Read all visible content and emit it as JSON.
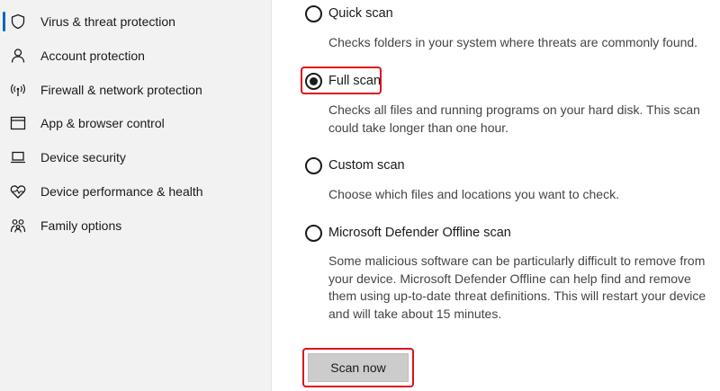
{
  "sidebar": {
    "items": [
      {
        "label": "Virus & threat protection",
        "icon": "shield-icon",
        "active": true
      },
      {
        "label": "Account protection",
        "icon": "person-icon"
      },
      {
        "label": "Firewall & network protection",
        "icon": "wifi-signal-icon"
      },
      {
        "label": "App & browser control",
        "icon": "browser-window-icon"
      },
      {
        "label": "Device security",
        "icon": "laptop-icon"
      },
      {
        "label": "Device performance & health",
        "icon": "heart-pulse-icon"
      },
      {
        "label": "Family options",
        "icon": "family-icon"
      }
    ]
  },
  "scan_options": [
    {
      "label": "Quick scan",
      "description": "Checks folders in your system where threats are commonly found.",
      "selected": false
    },
    {
      "label": "Full scan",
      "description": "Checks all files and running programs on your hard disk. This scan could take longer than one hour.",
      "selected": true
    },
    {
      "label": "Custom scan",
      "description": "Choose which files and locations you want to check.",
      "selected": false
    },
    {
      "label": "Microsoft Defender Offline scan",
      "description": "Some malicious software can be particularly difficult to remove from your device. Microsoft Defender Offline can help find and remove them using up-to-date threat definitions. This will restart your device and will take about 15 minutes.",
      "selected": false
    }
  ],
  "actions": {
    "scan_now_label": "Scan now"
  },
  "colors": {
    "highlight": "#e0101e",
    "accent": "#0067c0",
    "sidebar_bg": "#f2f2f2",
    "button_bg": "#cccccc"
  }
}
